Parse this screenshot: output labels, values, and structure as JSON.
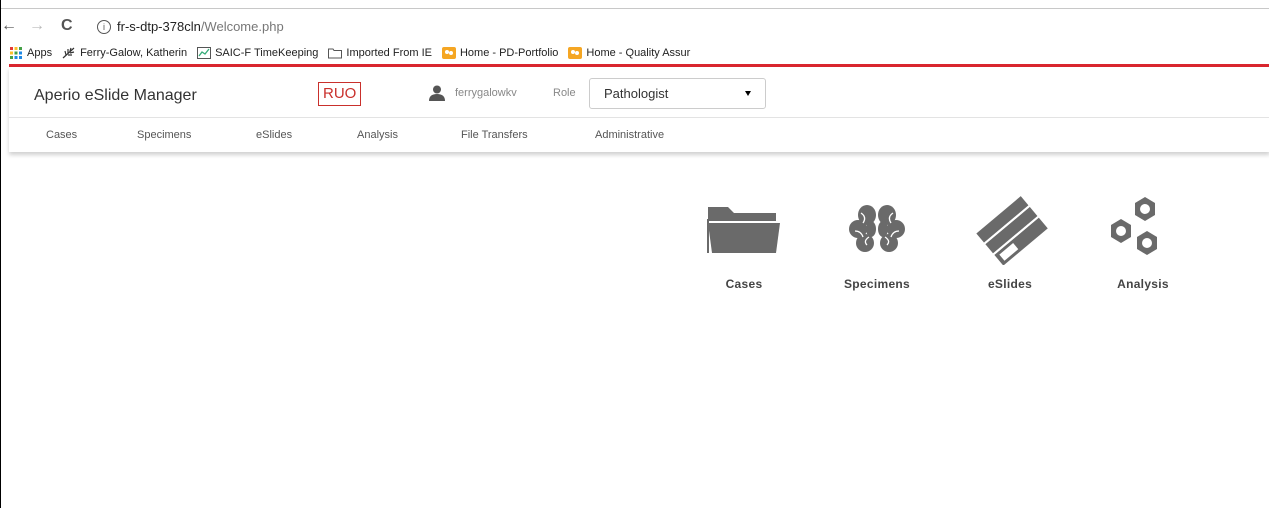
{
  "browser": {
    "back": "←",
    "forward": "→",
    "reload": "C",
    "url_host": "fr-s-dtp-378cln",
    "url_path": "/Welcome.php",
    "bookmarks": [
      {
        "label": "Apps",
        "icon": "apps-grid-icon"
      },
      {
        "label": "Ferry-Galow, Katherin",
        "icon": "feather-icon"
      },
      {
        "label": "SAIC-F TimeKeeping",
        "icon": "timekeeping-icon"
      },
      {
        "label": "Imported From IE",
        "icon": "folder-icon"
      },
      {
        "label": "Home - PD-Portfolio",
        "icon": "sharepoint-icon"
      },
      {
        "label": "Home - Quality Assur",
        "icon": "sharepoint-icon"
      }
    ]
  },
  "header": {
    "title": "Aperio eSlide Manager",
    "badge": "RUO",
    "username": "ferrygalowkv",
    "role_label": "Role",
    "role_value": "Pathologist"
  },
  "menu": [
    "Cases",
    "Specimens",
    "eSlides",
    "Analysis",
    "File Transfers",
    "Administrative"
  ],
  "tiles": [
    {
      "label": "Cases",
      "icon": "folder-icon"
    },
    {
      "label": "Specimens",
      "icon": "brain-icon"
    },
    {
      "label": "eSlides",
      "icon": "slides-icon"
    },
    {
      "label": "Analysis",
      "icon": "hexagons-icon"
    }
  ],
  "colors": {
    "accent_red": "#d9262e",
    "icon_gray": "#6a6a6a"
  }
}
